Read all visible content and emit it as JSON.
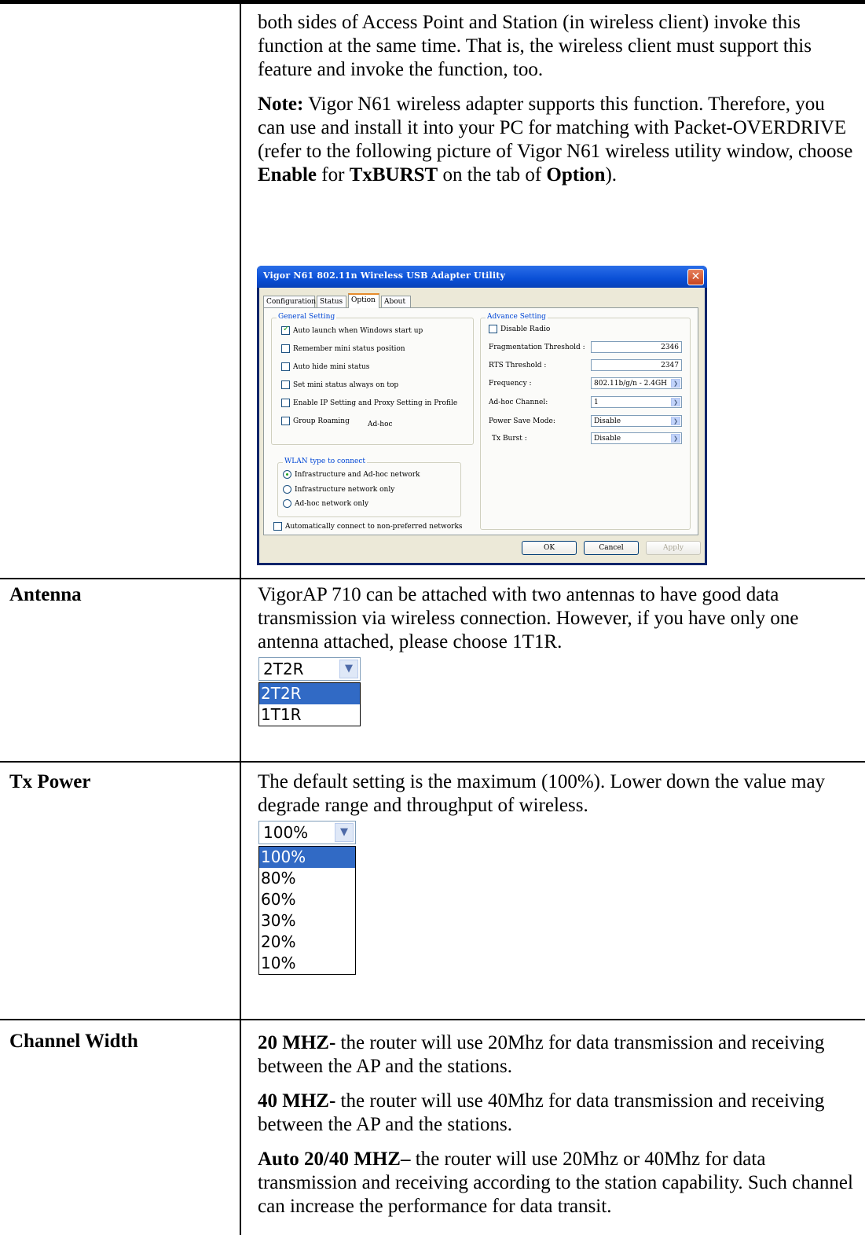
{
  "intro_paragraph": "both sides of Access Point and Station (in wireless client) invoke this function at the same time. That is, the wireless client must support this feature and invoke the function, too.",
  "note": {
    "label": "Note:",
    "text_1": " Vigor N61 wireless adapter supports this function. Therefore, you can use and install it into your PC for matching with Packet-OVERDRIVE (refer to the following picture of Vigor N61 wireless utility window, choose ",
    "bold_enable": "Enable",
    "text_2": " for ",
    "bold_txburst": "TxBURST",
    "text_3": " on the tab of ",
    "bold_option": "Option",
    "text_4": ")."
  },
  "dialog": {
    "title": "Vigor N61 802.11n Wireless USB Adapter Utility",
    "close_glyph": "✕",
    "tabs": [
      "Configuration",
      "Status",
      "Option",
      "About"
    ],
    "general_setting": {
      "title": "General Setting",
      "items": [
        {
          "label": "Auto launch when Windows start up",
          "checked": true
        },
        {
          "label": "Remember mini status position",
          "checked": false
        },
        {
          "label": "Auto hide mini status",
          "checked": false
        },
        {
          "label": "Set mini status always on top",
          "checked": false
        },
        {
          "label": "Enable IP Setting and Proxy Setting in Profile",
          "checked": false
        },
        {
          "label": "Group Roaming",
          "checked": false
        }
      ],
      "adhoc_text": "Ad-hoc"
    },
    "wlan_type": {
      "title": "WLAN type to connect",
      "options": [
        {
          "label": "Infrastructure and Ad-hoc network",
          "checked": true
        },
        {
          "label": "Infrastructure network only",
          "checked": false
        },
        {
          "label": "Ad-hoc network only",
          "checked": false
        }
      ]
    },
    "auto_connect_label": "Automatically connect to non-preferred networks",
    "advance_setting": {
      "title": "Advance Setting",
      "disable_radio": "Disable Radio",
      "frag_label": "Fragmentation Threshold :",
      "frag_value": "2346",
      "rts_label": "RTS Threshold :",
      "rts_value": "2347",
      "freq_label": "Frequency :",
      "freq_value": "802.11b/g/n - 2.4GH",
      "adhoc_channel_label": "Ad-hoc Channel:",
      "adhoc_channel_value": "1",
      "power_save_label": "Power Save Mode:",
      "power_save_value": "Disable",
      "txburst_label": "Tx Burst :",
      "txburst_value": "Disable"
    },
    "buttons": {
      "ok": "OK",
      "cancel": "Cancel",
      "apply": "Apply"
    }
  },
  "rows": {
    "antenna": {
      "label": "Antenna",
      "text": "VigorAP 710 can be attached with two antennas to have good data transmission via wireless connection. However, if you have only one antenna attached, please choose 1T1R.",
      "dropdown": {
        "selected": "2T2R",
        "options": [
          "2T2R",
          "1T1R"
        ]
      }
    },
    "tx_power": {
      "label": "Tx Power",
      "text": "The default setting is the maximum (100%). Lower down the value may degrade range and throughput of wireless.",
      "dropdown": {
        "selected": "100%",
        "options": [
          "100%",
          "80%",
          "60%",
          "30%",
          "20%",
          "10%"
        ]
      }
    },
    "channel_width": {
      "label": "Channel Width",
      "items": [
        {
          "bold": "20 MHZ-",
          "text": " the router will use 20Mhz for data transmission and receiving between the AP and the stations."
        },
        {
          "bold": "40 MHZ-",
          "text": " the router will use 40Mhz for data transmission and receiving between the AP and the stations."
        },
        {
          "bold": "Auto 20/40 MHZ–",
          "text": " the router will use 20Mhz or 40Mhz for data transmission and receiving according to the station capability. Such channel can increase the performance for data transit."
        }
      ]
    }
  },
  "dropdown_arrow_glyph": "❯"
}
